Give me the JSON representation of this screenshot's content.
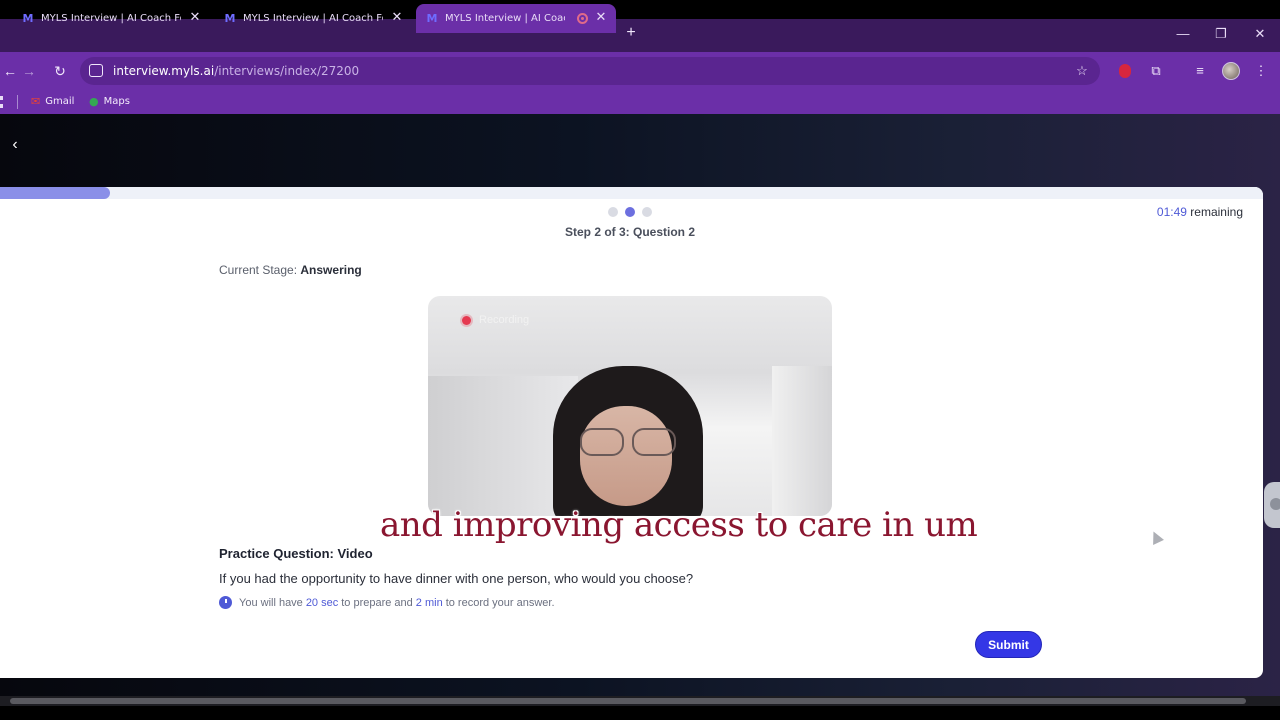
{
  "browser": {
    "tabs": [
      {
        "title": "MYLS Interview | AI Coach For I",
        "favicon": "M",
        "active": false
      },
      {
        "title": "MYLS Interview | AI Coach For I",
        "favicon": "M",
        "active": false
      },
      {
        "title": "MYLS Interview | AI Coach I",
        "favicon": "M",
        "active": true,
        "recording": true
      }
    ],
    "new_tab": "+",
    "address": {
      "domain": "interview.myls.ai",
      "path": "/interviews/index/27200"
    },
    "bookmarks": [
      {
        "label": "Gmail",
        "icon": "gmail-icon"
      },
      {
        "label": "Maps",
        "icon": "maps-icon"
      }
    ]
  },
  "interview": {
    "progress_fraction": 0.087,
    "steps_total": 3,
    "current_step": 2,
    "step_label": "Step 2 of 3: Question 2",
    "timer": {
      "time": "01:49",
      "suffix": "remaining"
    },
    "stage": {
      "prefix": "Current Stage:",
      "value": "Answering"
    },
    "recording_label": "Recording",
    "question_title": "Practice Question: Video",
    "question_text": "If you had the opportunity to have dinner with one person, who would you choose?",
    "info": {
      "part1": "You will have",
      "prep": "20 sec",
      "part2": "to prepare and",
      "record": "2 min",
      "part3": "to record your answer."
    },
    "submit_label": "Submit"
  },
  "caption": "and improving access to care in um",
  "colors": {
    "browser_frame": "#6b2fa8",
    "tabstrip": "#3a1a5c",
    "accent": "#3437e6",
    "progress": "#8a8fe8",
    "caption": "#8a1630"
  }
}
